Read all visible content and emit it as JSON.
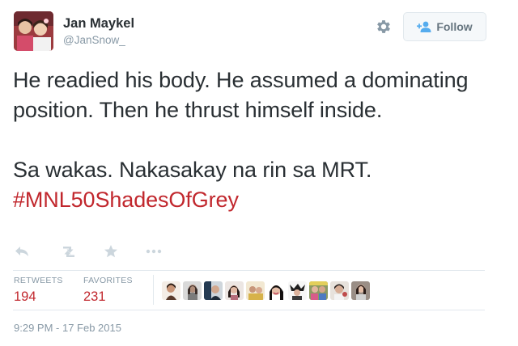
{
  "author": {
    "name": "Jan Maykel",
    "handle": "@JanSnow_"
  },
  "header": {
    "follow_label": "Follow"
  },
  "tweet": {
    "lines_1": "He readied his body. He assumed a dominating position. Then he thrust himself inside.",
    "lines_2": "Sa wakas. Nakasakay na rin sa MRT.",
    "hashtag": "#MNL50ShadesOfGrey"
  },
  "stats": {
    "retweets_label": "RETWEETS",
    "retweets_value": "194",
    "favorites_label": "FAVORITES",
    "favorites_value": "231"
  },
  "timestamp": "9:29 PM - 17 Feb 2015",
  "icons": {
    "reply": "reply-icon",
    "retweet": "retweet-icon",
    "favorite": "star-icon",
    "more": "more-icon",
    "settings": "gear-icon",
    "follow": "add-user-icon"
  },
  "colors": {
    "accent": "#c1272d",
    "muted": "#8899a6",
    "text": "#292f33",
    "action_icon": "#ccd6dd"
  }
}
